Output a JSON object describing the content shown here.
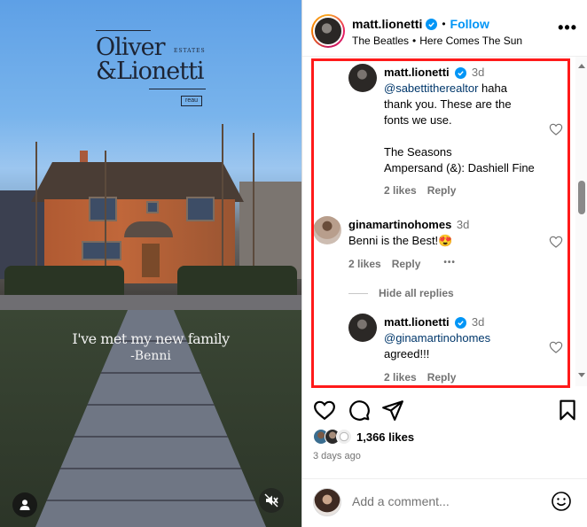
{
  "media": {
    "logo": {
      "line1": "Oliver",
      "estates": "ESTATES",
      "line2": "&Lionetti",
      "badge": "reau"
    },
    "quote": {
      "text": "I've met my new family",
      "author": "-Benni"
    },
    "icons": {
      "user_tag": "user-tag-icon",
      "mute": "speaker-muted-icon"
    }
  },
  "header": {
    "username": "matt.lionetti",
    "verified": true,
    "separator": "•",
    "follow_label": "Follow",
    "audio_artist": "The Beatles",
    "audio_separator": "•",
    "audio_track": "Here Comes The Sun",
    "more_label": "•••"
  },
  "comments": [
    {
      "username": "matt.lionetti",
      "verified": true,
      "time": "3d",
      "mention": "@sabettitherealtor",
      "text_lines": [
        " haha",
        "thank you. These are the",
        "fonts we use.",
        "",
        "The Seasons",
        "Ampersand (&): Dashiell Fine"
      ],
      "likes": "2 likes",
      "reply_label": "Reply"
    },
    {
      "username": "ginamartinohomes",
      "verified": false,
      "time": "3d",
      "text": "Benni is the Best!",
      "emoji": "😍",
      "likes": "2 likes",
      "reply_label": "Reply",
      "more_label": "•••"
    },
    {
      "username": "matt.lionetti",
      "verified": true,
      "time": "3d",
      "mention": "@ginamartinohomes",
      "text": "agreed!!!",
      "likes": "2 likes",
      "reply_label": "Reply"
    }
  ],
  "hide_replies_label": "Hide all replies",
  "highlight_color": "#ff1a1a",
  "footer": {
    "likes_count": "1,366 likes",
    "time_ago": "3 days ago",
    "comment_placeholder": "Add a comment...",
    "comment_value": ""
  },
  "colors": {
    "accent": "#0095f6",
    "secondary_text": "#737373",
    "mention": "#00376b"
  }
}
